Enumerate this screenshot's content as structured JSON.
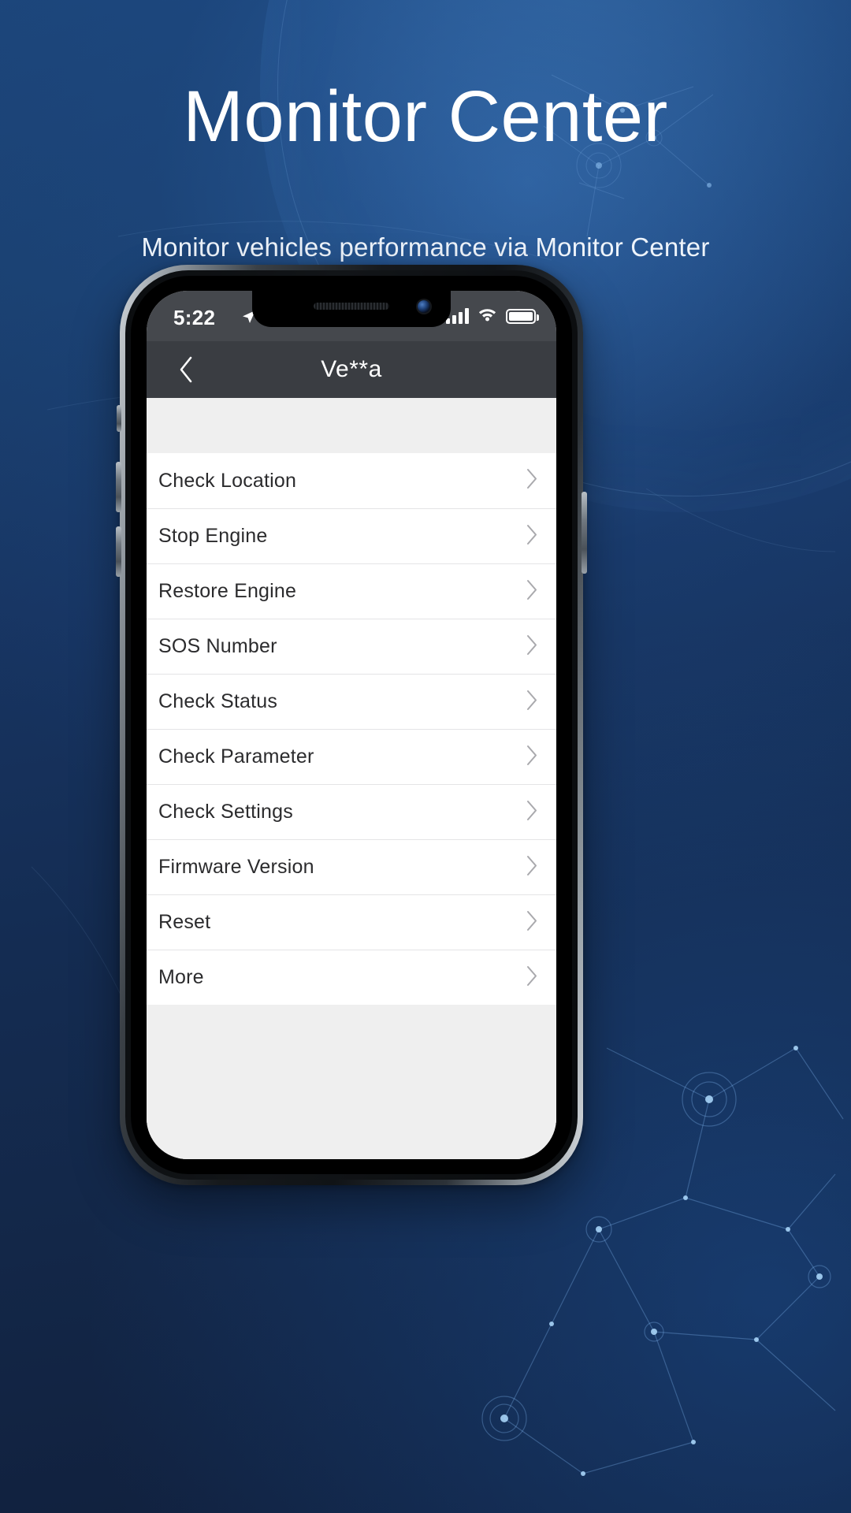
{
  "hero": {
    "title": "Monitor Center",
    "subtitle": "Monitor vehicles performance via Monitor Center"
  },
  "colors": {
    "background_top": "#1b4478",
    "background_bottom": "#101f3b",
    "navbar": "#3a3d42",
    "statusbar": "#45484d",
    "list_background": "#ffffff",
    "page_background": "#efefef",
    "chevron": "#a9a9ad",
    "text_primary": "#2b2b2d"
  },
  "phone": {
    "statusbar": {
      "time": "5:22",
      "location_icon": "location-arrow-icon",
      "signal_icon": "cellular-signal-icon",
      "wifi_icon": "wifi-icon",
      "battery_icon": "battery-full-icon"
    },
    "navbar": {
      "back_icon": "chevron-left-icon",
      "title": "Ve**a"
    },
    "list": {
      "chevron_icon": "chevron-right-icon",
      "items": [
        {
          "label": "Check Location"
        },
        {
          "label": "Stop Engine"
        },
        {
          "label": "Restore Engine"
        },
        {
          "label": "SOS Number"
        },
        {
          "label": "Check Status"
        },
        {
          "label": "Check Parameter"
        },
        {
          "label": "Check Settings"
        },
        {
          "label": "Firmware Version"
        },
        {
          "label": "Reset"
        },
        {
          "label": "More"
        }
      ]
    }
  }
}
